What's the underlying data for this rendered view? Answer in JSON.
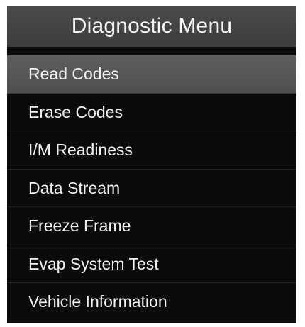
{
  "title": "Diagnostic Menu",
  "menu": {
    "items": [
      {
        "label": "Read Codes",
        "selected": true
      },
      {
        "label": "Erase Codes",
        "selected": false
      },
      {
        "label": "I/M Readiness",
        "selected": false
      },
      {
        "label": "Data Stream",
        "selected": false
      },
      {
        "label": "Freeze Frame",
        "selected": false
      },
      {
        "label": "Evap System Test",
        "selected": false
      },
      {
        "label": "Vehicle Information",
        "selected": false
      }
    ]
  },
  "colors": {
    "background": "#0b0b0b",
    "title_bar": "#444444",
    "selected_row": "#575757",
    "text": "#f2f2f2"
  }
}
